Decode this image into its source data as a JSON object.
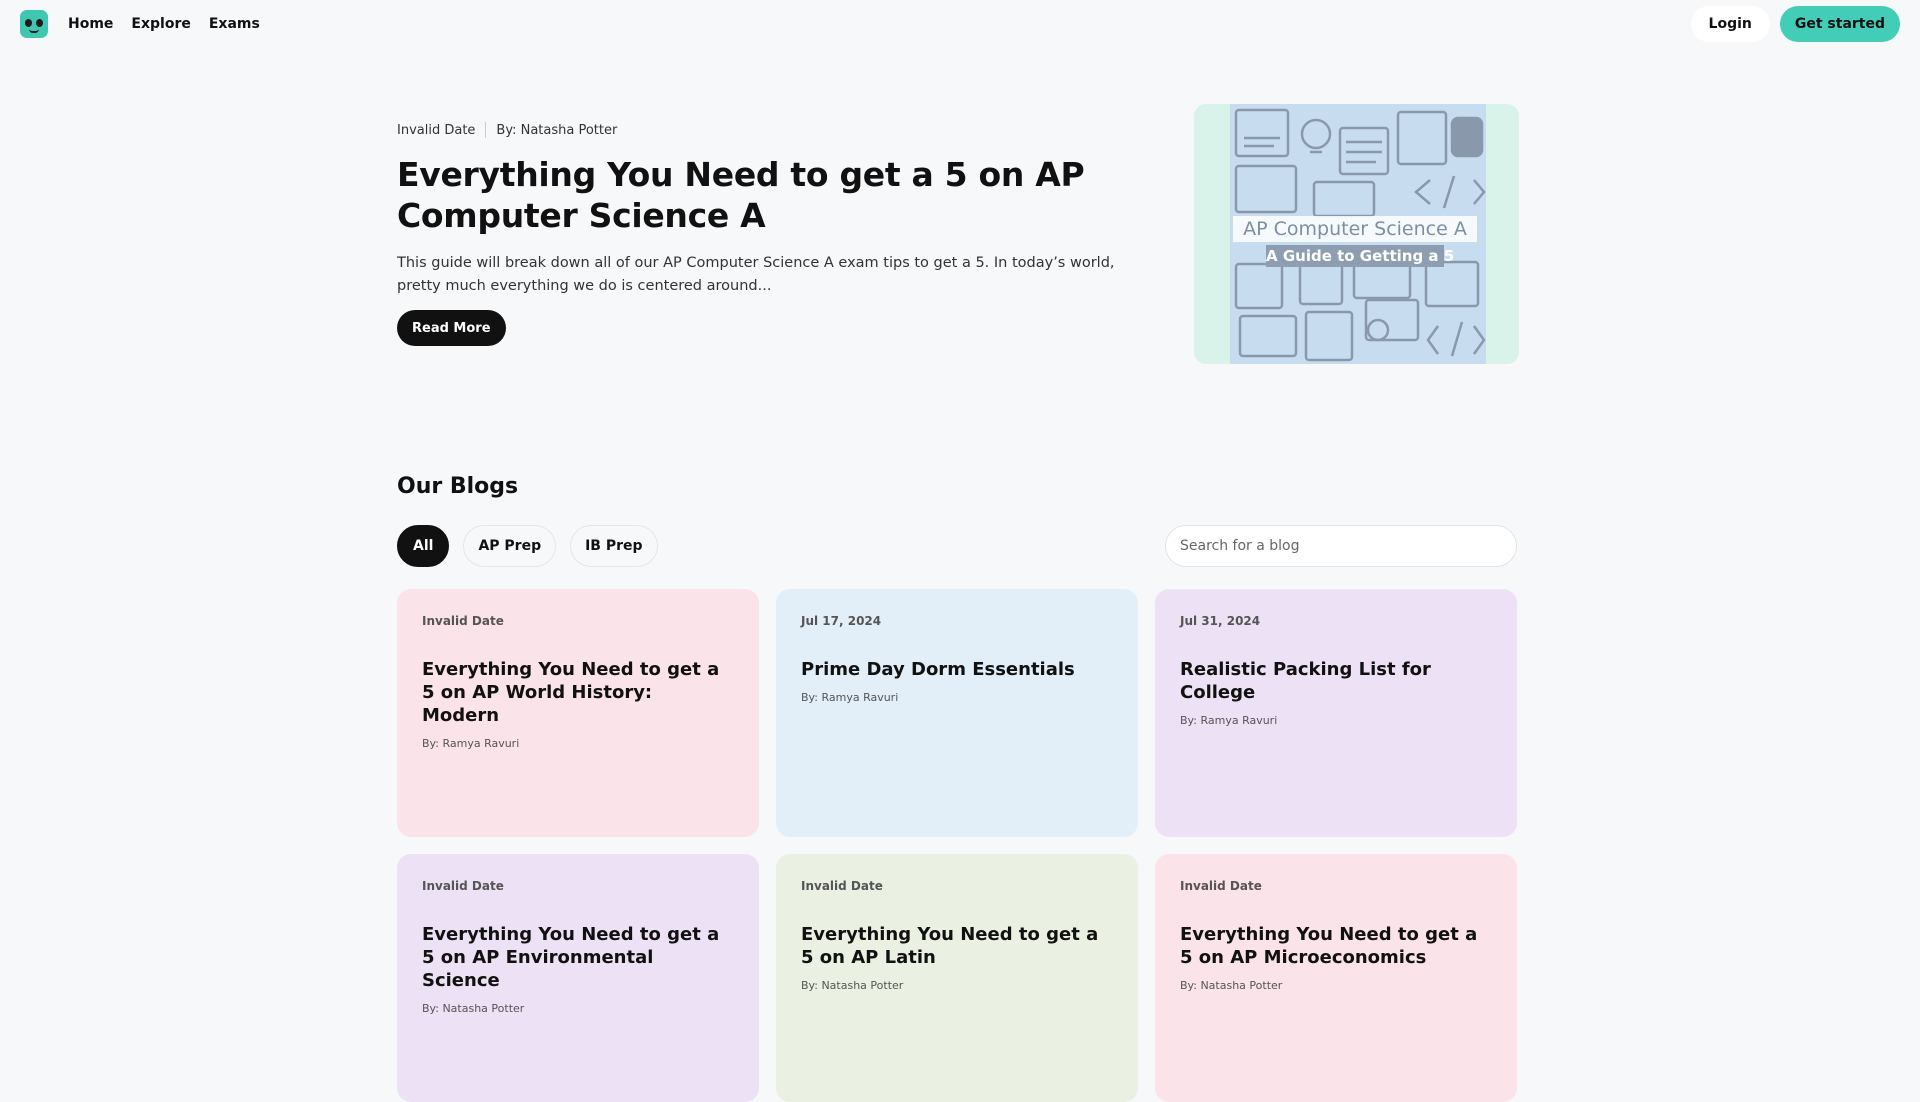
{
  "nav": {
    "links": [
      "Home",
      "Explore",
      "Exams"
    ],
    "login": "Login",
    "get_started": "Get started"
  },
  "hero": {
    "date": "Invalid Date",
    "author": "By: Natasha Potter",
    "title": "Everything You Need to get a 5 on AP Computer Science A",
    "description": "This guide will break down all of our AP Computer Science A exam tips to get a 5.  In today’s world, pretty much everything we do is centered around...",
    "read_more": "Read More",
    "image_title": "AP Computer Science A",
    "image_subtitle": "A Guide to Getting a 5"
  },
  "blogs": {
    "heading": "Our Blogs",
    "filters": [
      "All",
      "AP Prep",
      "IB Prep"
    ],
    "active_filter": "All",
    "search_placeholder": "Search for a blog",
    "cards": [
      {
        "date": "Invalid Date",
        "title": "Everything You Need to get a 5 on AP World History: Modern",
        "author": "By: Ramya Ravuri",
        "color": "#fbe3ea"
      },
      {
        "date": "Jul 17, 2024",
        "title": "Prime Day Dorm Essentials",
        "author": "By: Ramya Ravuri",
        "color": "#e2eff9"
      },
      {
        "date": "Jul 31, 2024",
        "title": "Realistic Packing List for College",
        "author": "By: Ramya Ravuri",
        "color": "#ede1f5"
      },
      {
        "date": "Invalid Date",
        "title": "Everything You Need to get a 5 on AP Environmental Science",
        "author": "By: Natasha Potter",
        "color": "#ede1f5"
      },
      {
        "date": "Invalid Date",
        "title": "Everything You Need to get a 5 on AP Latin",
        "author": "By: Natasha Potter",
        "color": "#eaf1e2"
      },
      {
        "date": "Invalid Date",
        "title": "Everything You Need to get a 5 on AP Microeconomics",
        "author": "By: Natasha Potter",
        "color": "#fbe3ea"
      }
    ]
  },
  "colors": {
    "accent": "#43ccb6",
    "dark": "#111111",
    "background": "#f7f8fa"
  }
}
